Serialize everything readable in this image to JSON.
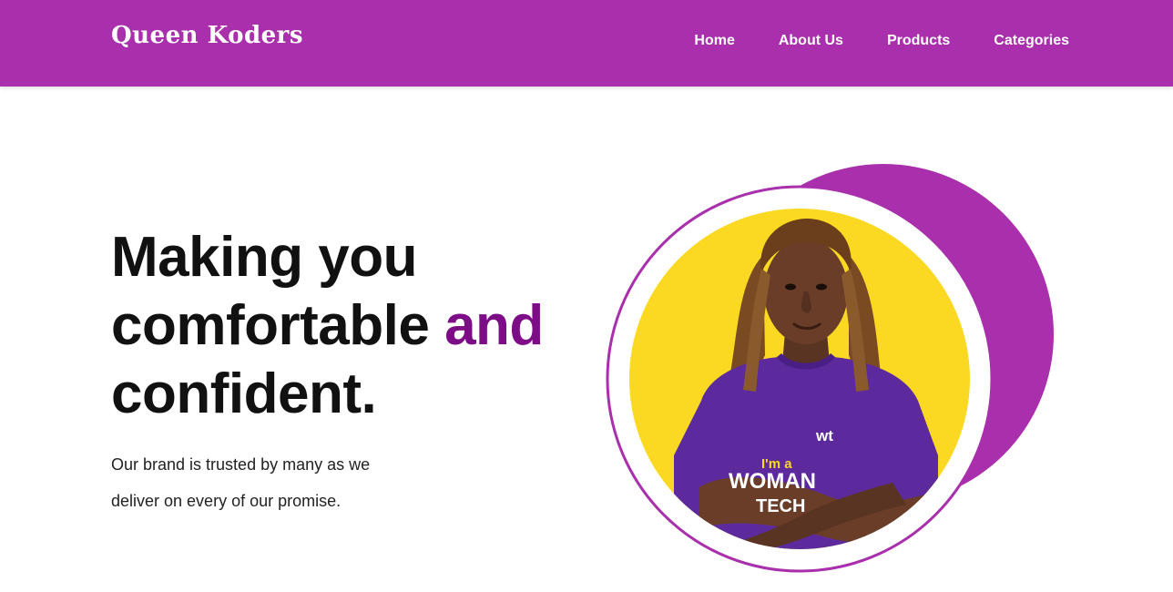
{
  "brand": {
    "name": "Queen Koders"
  },
  "nav": {
    "items": [
      {
        "label": "Home"
      },
      {
        "label": "About Us"
      },
      {
        "label": "Products"
      },
      {
        "label": "Categories"
      }
    ]
  },
  "hero": {
    "headline_part1": "Making you",
    "headline_part2": "comfortable",
    "headline_accent": "and",
    "headline_part3": "confident.",
    "tagline_line1": "Our brand is trusted by many as we",
    "tagline_line2": "deliver on every of our promise.",
    "image": {
      "shirt_logo": "wt",
      "shirt_text_line1": "I'm a",
      "shirt_text_line2": "WOMAN",
      "shirt_text_line3": "TECH"
    }
  },
  "colors": {
    "brand_purple": "#a92fac",
    "accent_purple": "#7c0d86",
    "circle_yellow": "#fbd922"
  }
}
